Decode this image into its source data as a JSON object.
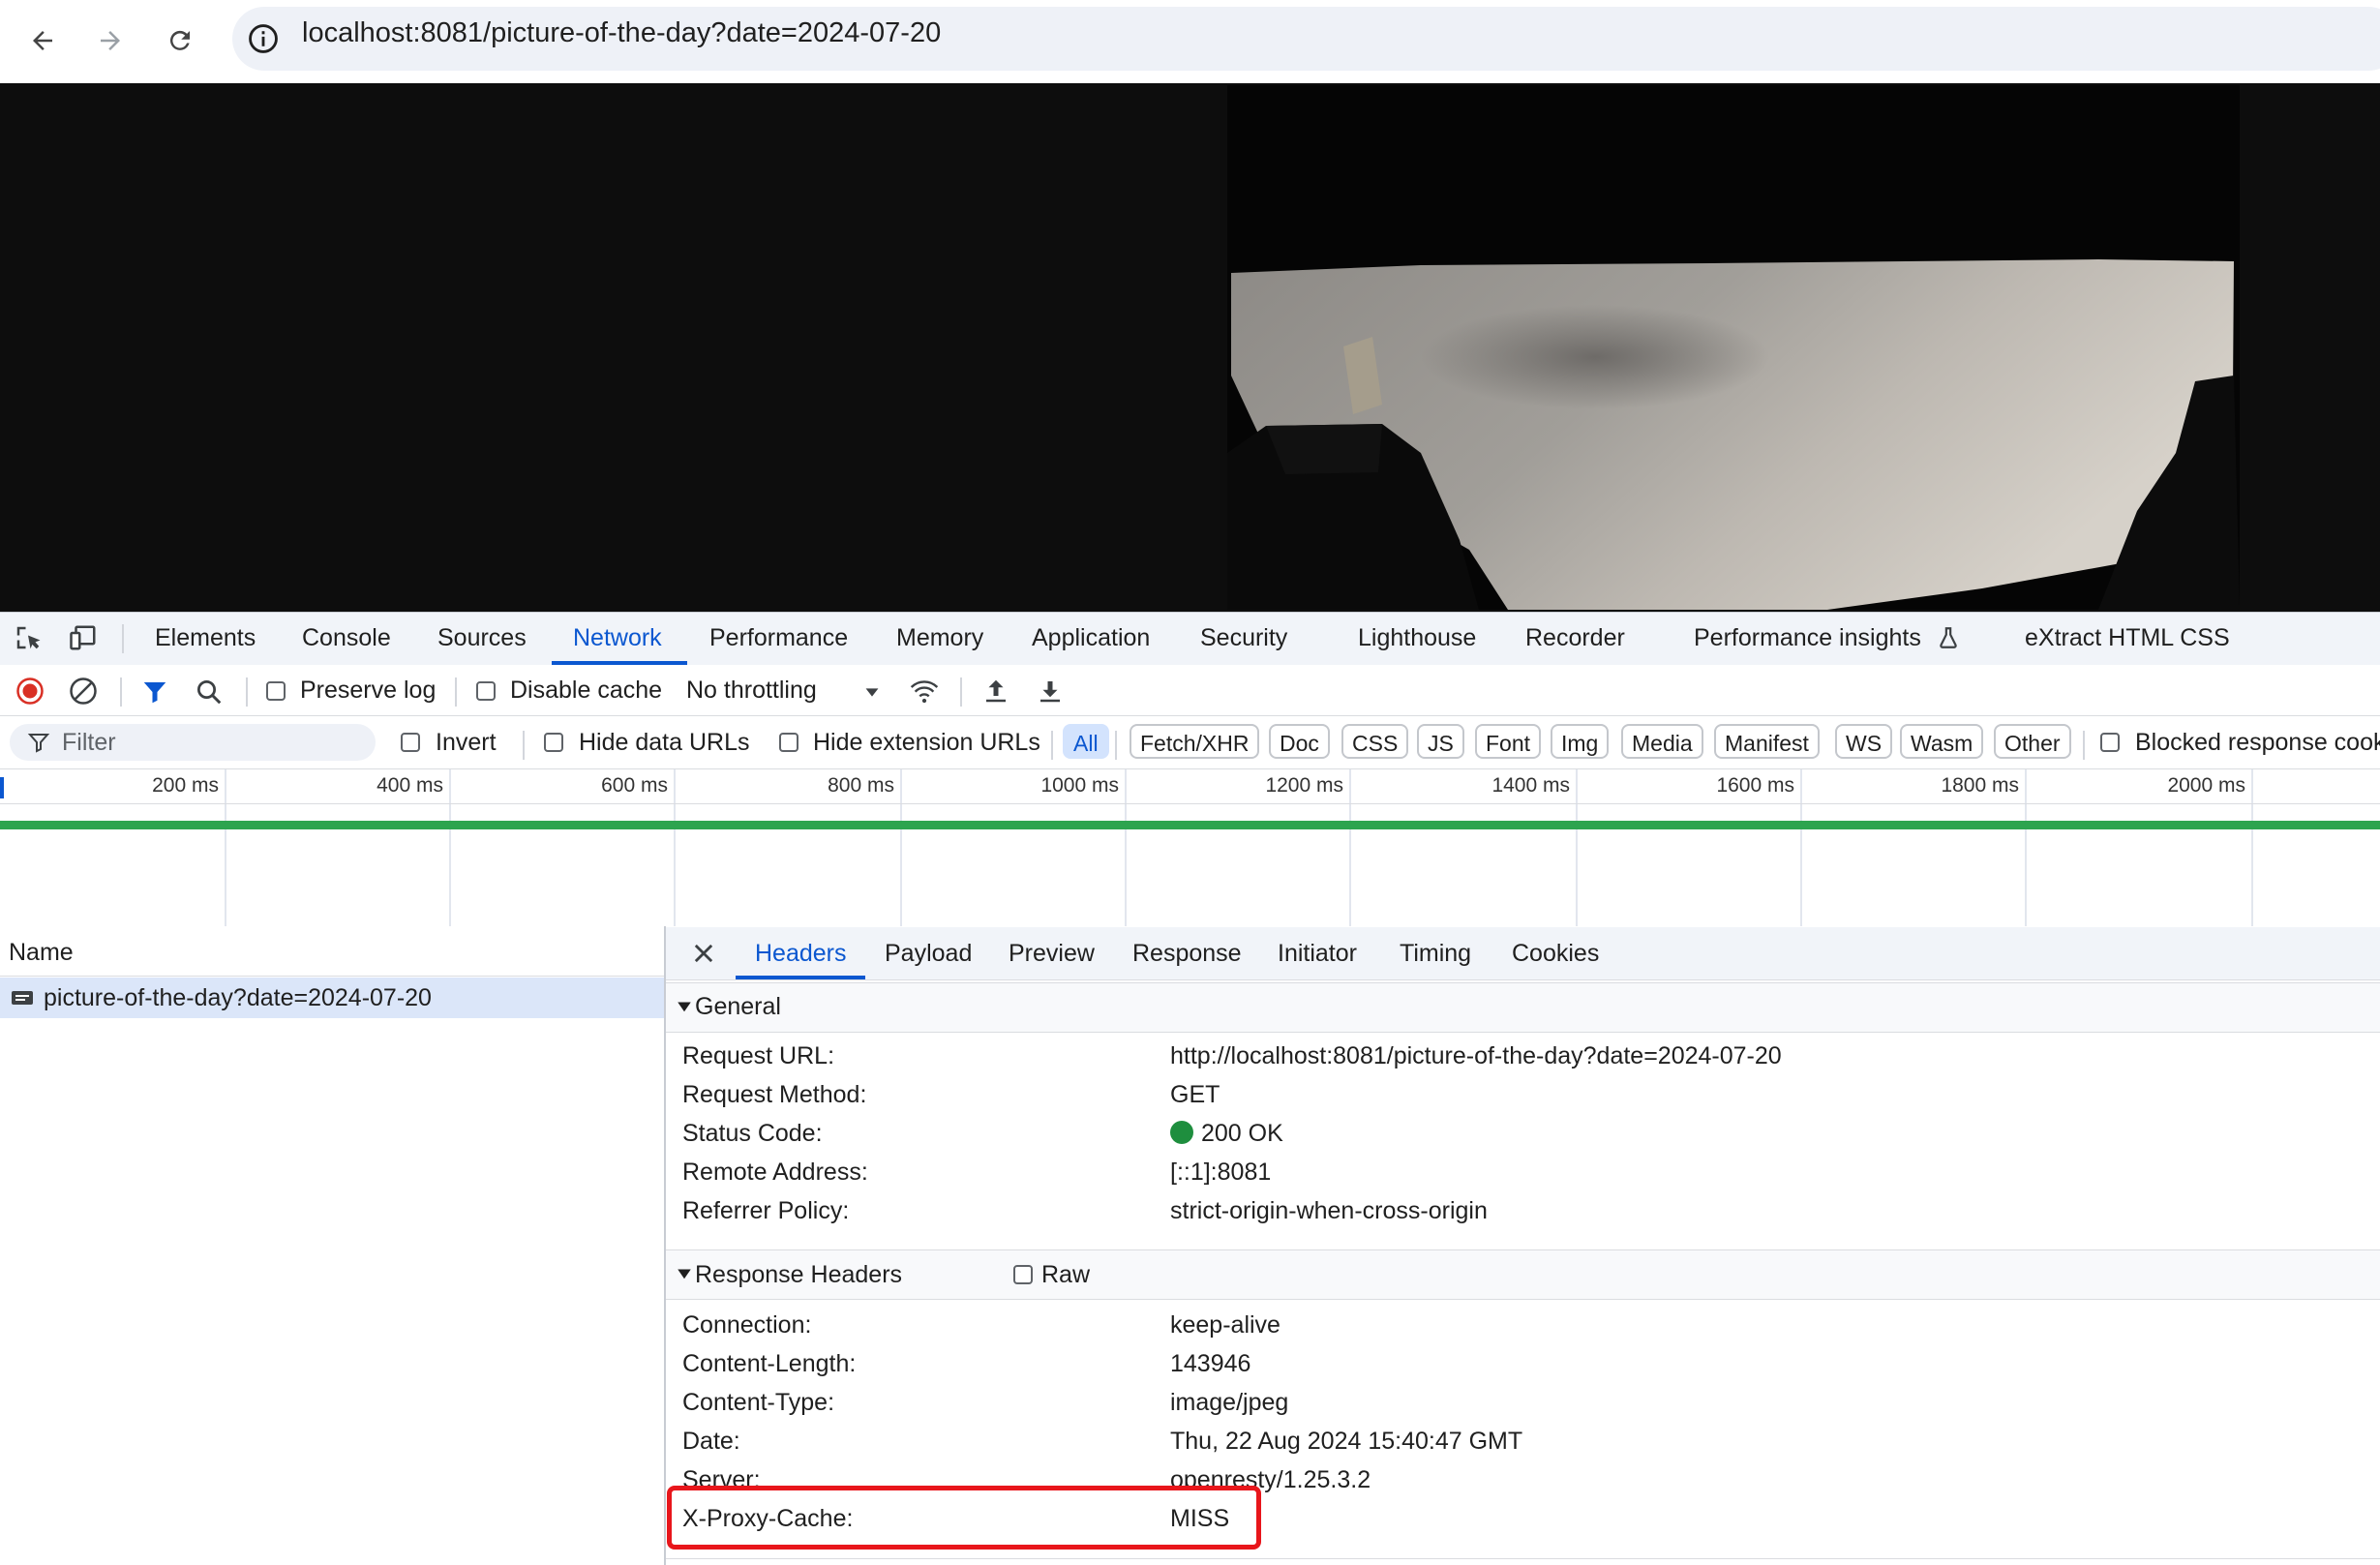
{
  "browser": {
    "url": "localhost:8081/picture-of-the-day?date=2024-07-20",
    "back_icon": "arrow-left-icon",
    "forward_icon": "arrow-right-icon",
    "reload_icon": "reload-icon",
    "site_info_icon": "info-icon"
  },
  "devtools": {
    "tabs": [
      "Elements",
      "Console",
      "Sources",
      "Network",
      "Performance",
      "Memory",
      "Application",
      "Security",
      "Lighthouse",
      "Recorder",
      "Performance insights",
      "eXtract HTML CSS"
    ],
    "active_tab": "Network",
    "toolbar": {
      "preserve_log": "Preserve log",
      "disable_cache": "Disable cache",
      "throttling": "No throttling"
    },
    "filterbar": {
      "filter_placeholder": "Filter",
      "invert": "Invert",
      "hide_data_urls": "Hide data URLs",
      "hide_extension_urls": "Hide extension URLs",
      "types": [
        "All",
        "Fetch/XHR",
        "Doc",
        "CSS",
        "JS",
        "Font",
        "Img",
        "Media",
        "Manifest",
        "WS",
        "Wasm",
        "Other"
      ],
      "active_type": "All",
      "blocked_response_cookies": "Blocked response cook"
    },
    "timeline": {
      "ticks": [
        "200 ms",
        "400 ms",
        "600 ms",
        "800 ms",
        "1000 ms",
        "1200 ms",
        "1400 ms",
        "1600 ms",
        "1800 ms",
        "2000 ms"
      ]
    },
    "requests": {
      "column_name": "Name",
      "rows": [
        {
          "name": "picture-of-the-day?date=2024-07-20"
        }
      ]
    },
    "details": {
      "tabs": [
        "Headers",
        "Payload",
        "Preview",
        "Response",
        "Initiator",
        "Timing",
        "Cookies"
      ],
      "active_tab": "Headers",
      "general": {
        "title": "General",
        "rows": [
          {
            "name": "Request URL:",
            "value": "http://localhost:8081/picture-of-the-day?date=2024-07-20"
          },
          {
            "name": "Request Method:",
            "value": "GET"
          },
          {
            "name": "Status Code:",
            "value": "200 OK"
          },
          {
            "name": "Remote Address:",
            "value": "[::1]:8081"
          },
          {
            "name": "Referrer Policy:",
            "value": "strict-origin-when-cross-origin"
          }
        ]
      },
      "response_headers": {
        "title": "Response Headers",
        "raw_label": "Raw",
        "rows": [
          {
            "name": "Connection:",
            "value": "keep-alive"
          },
          {
            "name": "Content-Length:",
            "value": "143946"
          },
          {
            "name": "Content-Type:",
            "value": "image/jpeg"
          },
          {
            "name": "Date:",
            "value": "Thu, 22 Aug 2024 15:40:47 GMT"
          },
          {
            "name": "Server:",
            "value": "openresty/1.25.3.2"
          },
          {
            "name": "X-Proxy-Cache:",
            "value": "MISS"
          }
        ]
      }
    }
  },
  "colors": {
    "accent": "#0b57d0",
    "highlight": "#e8161b",
    "status_ok": "#1e8e3e",
    "timeline_bar": "#2da44e"
  }
}
